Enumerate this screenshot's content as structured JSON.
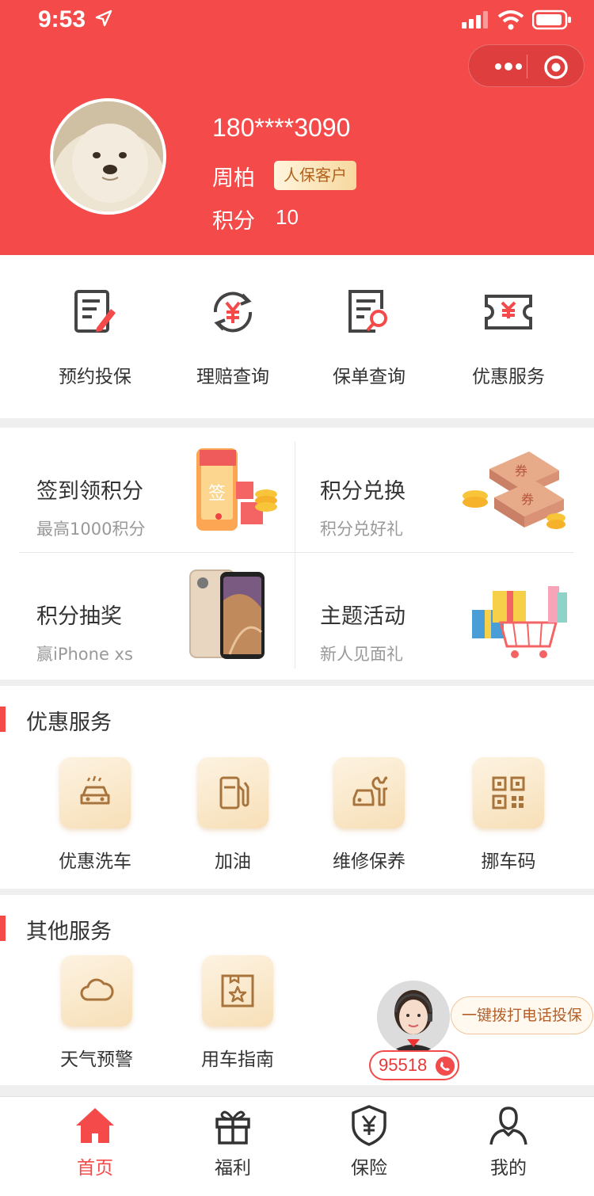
{
  "status_bar": {
    "time": "9:53"
  },
  "profile": {
    "phone": "180****3090",
    "name": "周柏",
    "badge": "人保客户",
    "points_label": "积分",
    "points_value": "10"
  },
  "quick_actions": [
    {
      "label": "预约投保",
      "icon": "form-edit-icon"
    },
    {
      "label": "理赔查询",
      "icon": "yuan-refresh-icon"
    },
    {
      "label": "保单查询",
      "icon": "doc-search-icon"
    },
    {
      "label": "优惠服务",
      "icon": "coupon-icon"
    }
  ],
  "promos": [
    {
      "title": "签到领积分",
      "subtitle": "最高1000积分",
      "image": "checkin-illustration"
    },
    {
      "title": "积分兑换",
      "subtitle": "积分兑好礼",
      "image": "coupon-coins-illustration"
    },
    {
      "title": "积分抽奖",
      "subtitle": "赢iPhone xs",
      "image": "iphone-illustration"
    },
    {
      "title": "主题活动",
      "subtitle": "新人见面礼",
      "image": "gift-cart-illustration"
    }
  ],
  "discount_services": {
    "title": "优惠服务",
    "items": [
      {
        "label": "优惠洗车",
        "icon": "car-wash-icon"
      },
      {
        "label": "加油",
        "icon": "fuel-pump-icon"
      },
      {
        "label": "维修保养",
        "icon": "car-wrench-icon"
      },
      {
        "label": "挪车码",
        "icon": "qr-code-icon"
      }
    ]
  },
  "other_services": {
    "title": "其他服务",
    "items": [
      {
        "label": "天气预警",
        "icon": "cloud-icon"
      },
      {
        "label": "用车指南",
        "icon": "star-book-icon"
      }
    ]
  },
  "call_widget": {
    "tip": "一键拨打电话投保",
    "hotline": "95518"
  },
  "tabbar": {
    "items": [
      {
        "label": "首页",
        "icon": "home-icon",
        "active": true
      },
      {
        "label": "福利",
        "icon": "gift-icon",
        "active": false
      },
      {
        "label": "保险",
        "icon": "shield-yuan-icon",
        "active": false
      },
      {
        "label": "我的",
        "icon": "user-icon",
        "active": false
      }
    ]
  },
  "colors": {
    "brand_red": "#f44a4a",
    "tile_gold": "#f7dfb7",
    "badge_text": "#b0621e"
  }
}
